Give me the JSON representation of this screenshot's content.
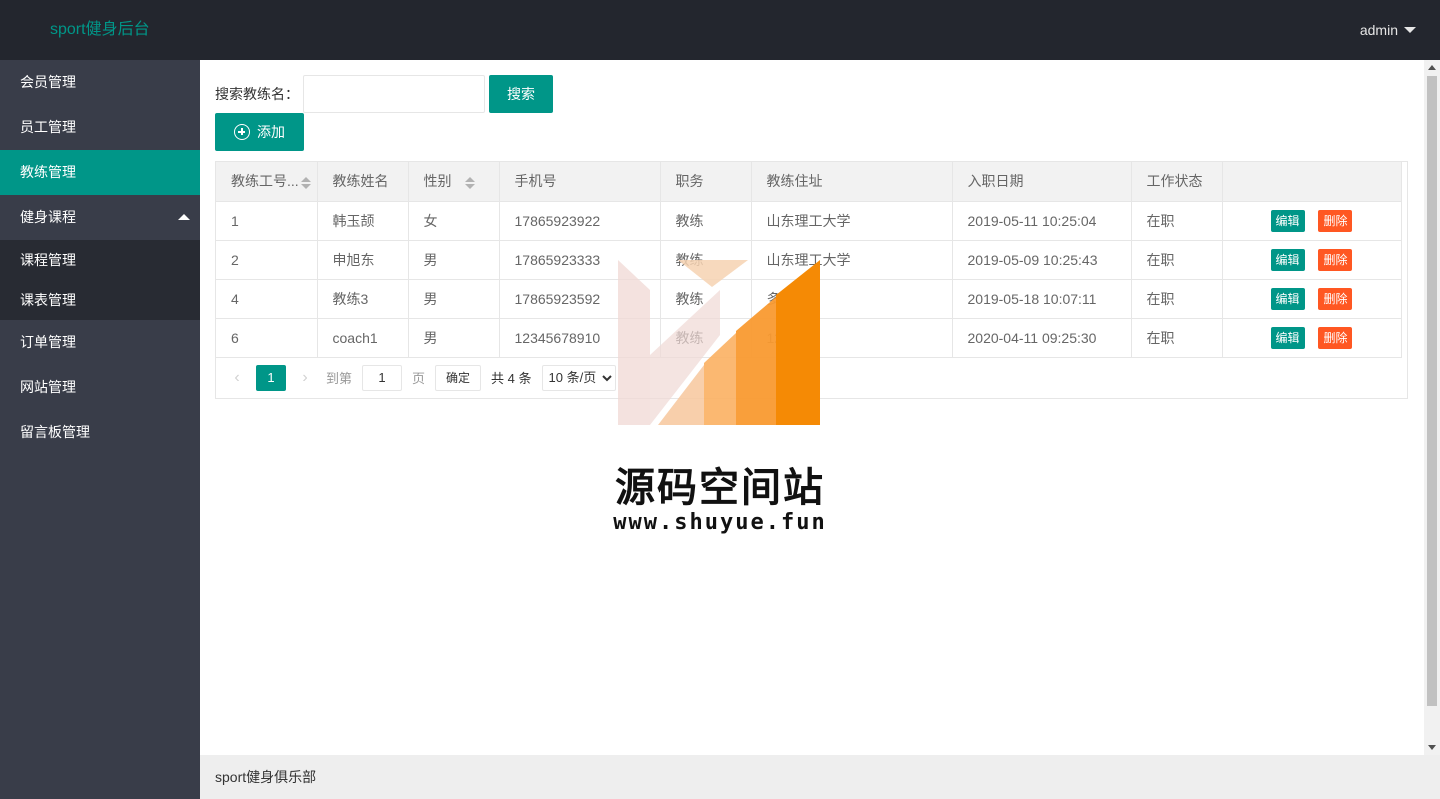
{
  "app": {
    "logo": "sport健身后台",
    "user": "admin"
  },
  "sidebar": {
    "items": [
      {
        "label": "会员管理"
      },
      {
        "label": "员工管理"
      },
      {
        "label": "教练管理"
      },
      {
        "label": "健身课程"
      },
      {
        "label": "订单管理"
      },
      {
        "label": "网站管理"
      },
      {
        "label": "留言板管理"
      }
    ],
    "children": [
      {
        "label": "课程管理"
      },
      {
        "label": "课表管理"
      }
    ]
  },
  "search": {
    "label": "搜索教练名：",
    "value": "",
    "button": "搜索"
  },
  "toolbar": {
    "add_label": "添加"
  },
  "table": {
    "headers": [
      "教练工号...",
      "教练姓名",
      "性别",
      "手机号",
      "职务",
      "教练住址",
      "入职日期",
      "工作状态",
      ""
    ],
    "rows": [
      [
        "1",
        "韩玉颉",
        "女",
        "17865923922",
        "教练",
        "山东理工大学",
        "2019-05-11 10:25:04",
        "在职"
      ],
      [
        "2",
        "申旭东",
        "男",
        "17865923333",
        "教练",
        "山东理工大学",
        "2019-05-09 10:25:43",
        "在职"
      ],
      [
        "4",
        "教练3",
        "男",
        "17865923592",
        "教练",
        "多对",
        "2019-05-18 10:07:11",
        "在职"
      ],
      [
        "6",
        "coach1",
        "男",
        "12345678910",
        "教练",
        "123",
        "2020-04-11 09:25:30",
        "在职"
      ]
    ],
    "edit_label": "编辑",
    "delete_label": "删除"
  },
  "pager": {
    "prev": "‹",
    "current": "1",
    "next": "›",
    "goto_label": "到第",
    "goto_value": "1",
    "page_label": "页",
    "ok_label": "确定",
    "count_label": "共 4 条",
    "page_size": "10 条/页"
  },
  "footer": {
    "text": "sport健身俱乐部"
  },
  "watermark": {
    "title": "源码空间站",
    "url": "www.shuyue.fun"
  },
  "colors": {
    "primary": "#009688",
    "danger": "#ff5722",
    "header": "#23262e",
    "sidebar": "#393d49"
  }
}
